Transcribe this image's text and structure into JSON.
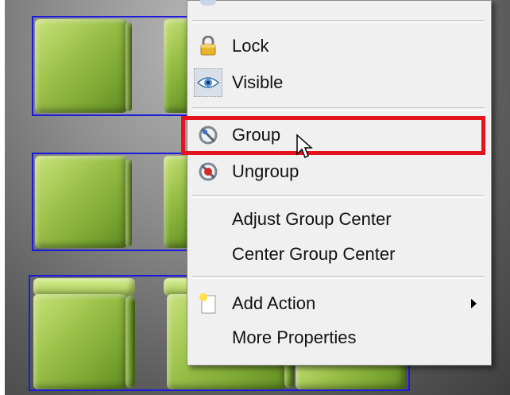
{
  "menu": {
    "items": [
      {
        "label": "Lock",
        "icon": "lock-icon"
      },
      {
        "label": "Visible",
        "icon": "eye-icon"
      },
      {
        "label": "Group",
        "icon": "group-icon"
      },
      {
        "label": "Ungroup",
        "icon": "ungroup-icon"
      },
      {
        "label": "Adjust Group Center"
      },
      {
        "label": "Center Group Center"
      },
      {
        "label": "Add Action",
        "icon": "add-action-icon",
        "has_submenu": true
      },
      {
        "label": "More Properties"
      }
    ]
  },
  "highlight": {
    "target": "Group",
    "color": "#e3141e"
  },
  "colors": {
    "cube": "#9cc24a",
    "selection": "#1b1bd8",
    "menu_bg": "#f0f0f0"
  }
}
